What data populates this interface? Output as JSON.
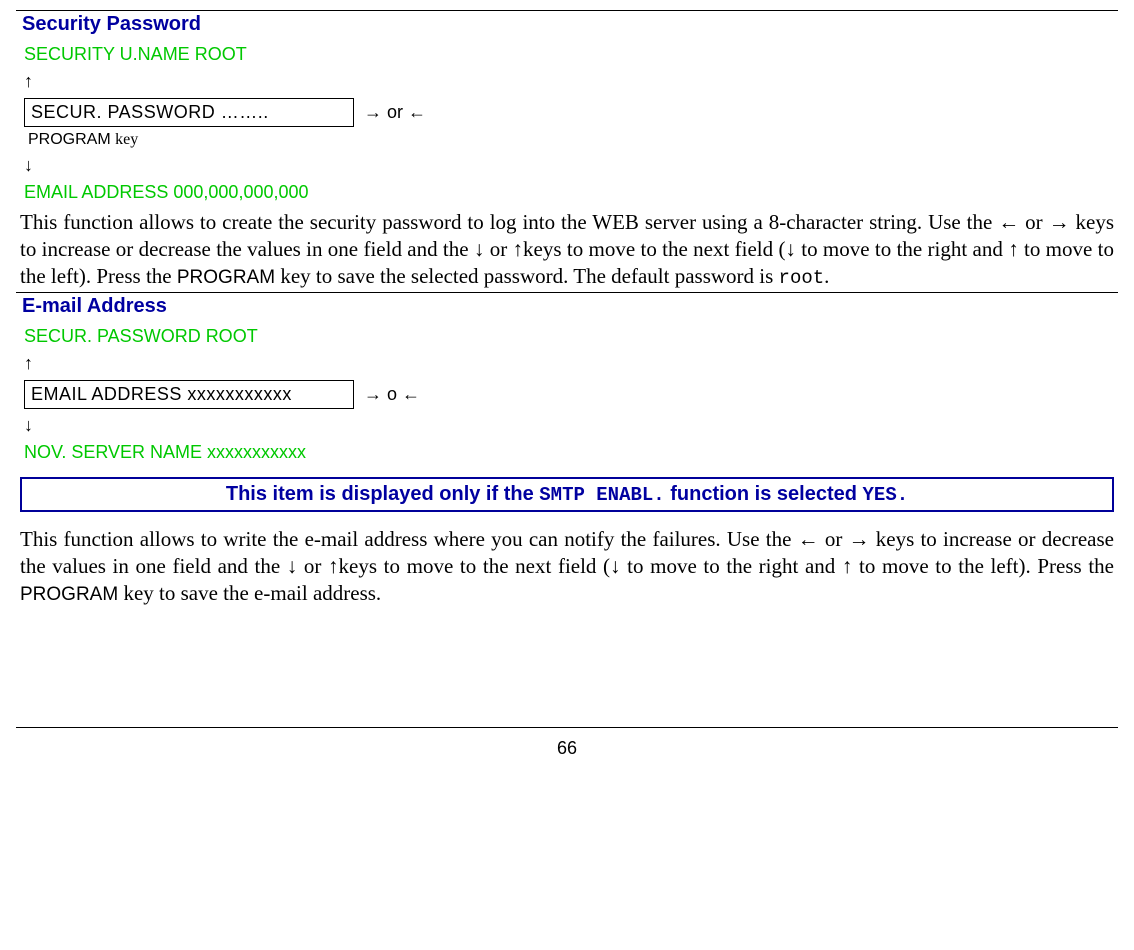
{
  "section1": {
    "title": "Security Password",
    "prevItem": "SECURITY U.NAME  ROOT",
    "upArrow": "↑",
    "displayText": "SECUR.  PASSWORD ……..",
    "navHint": "→ or ←",
    "keyNote_sans": "PROGRAM ",
    "keyNote_serif": "key",
    "downArrow": "↓",
    "nextItem": "EMAIL ADDRESS 000,000,000,000",
    "body_p1": "This function allows to create the security password to log into the WEB server using a 8-character string. Use the ← or → keys to increase or decrease the values in one field and the ↓ or ↑keys to move to the next field (↓ to move to the right and ↑ to move to the left).  Press the ",
    "body_key": "PROGRAM",
    "body_p2": " key to save the selected password. The default password is ",
    "body_default": "root",
    "body_p3": "."
  },
  "section2": {
    "title": "E-mail Address",
    "prevItem": "SECUR.  PASSWORD ROOT",
    "upArrow": "↑",
    "displayText": "EMAIL  ADDRESS   xxxxxxxxxxx",
    "navHint": "→ o ←",
    "downArrow": "↓",
    "nextItem": "NOV. SERVER NAME  xxxxxxxxxxx",
    "notice_p1": "This item is displayed only if the ",
    "notice_code1": "SMTP ENABL.",
    "notice_p2": " function is selected ",
    "notice_code2": "YES.",
    "body_p1": "This function allows to write the e-mail address where you can notify the failures. Use the ← or → keys to increase or decrease the values in one field and the ↓ or ↑keys to move to the next field (↓ to move to the right and ↑ to move to the left). Press the ",
    "body_key": "PROGRAM",
    "body_p2": " key to save the e-mail address."
  },
  "pageNumber": "66"
}
